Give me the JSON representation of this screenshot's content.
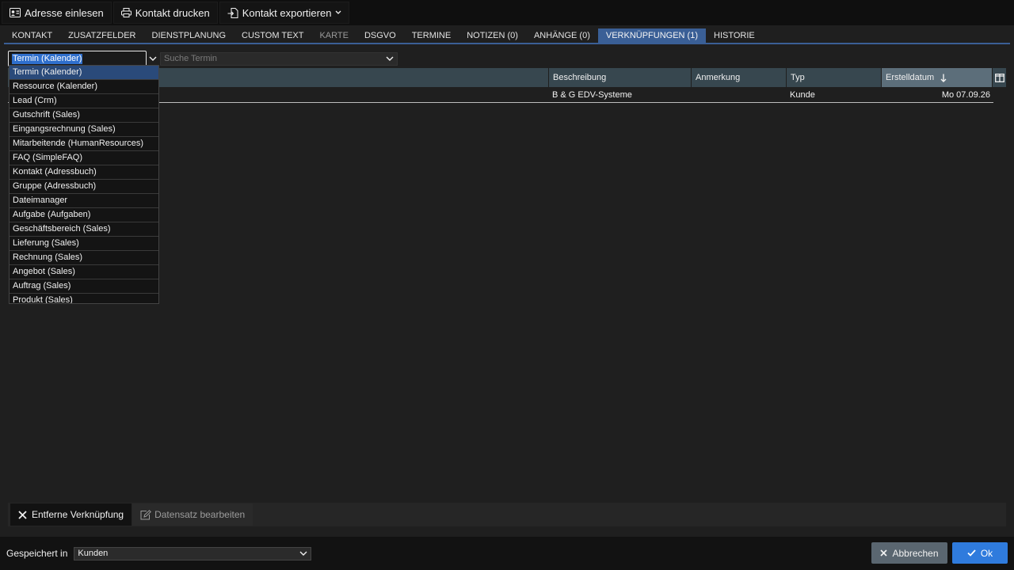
{
  "toolbar": {
    "import_address": "Adresse einlesen",
    "print_contact": "Kontakt drucken",
    "export_contact": "Kontakt exportieren"
  },
  "tabs": [
    {
      "label": "KONTAKT",
      "state": "normal"
    },
    {
      "label": "ZUSATZFELDER",
      "state": "normal"
    },
    {
      "label": "DIENSTPLANUNG",
      "state": "normal"
    },
    {
      "label": "CUSTOM TEXT",
      "state": "normal"
    },
    {
      "label": "KARTE",
      "state": "disabled"
    },
    {
      "label": "DSGVO",
      "state": "normal"
    },
    {
      "label": "TERMINE",
      "state": "normal"
    },
    {
      "label": "NOTIZEN (0)",
      "state": "normal"
    },
    {
      "label": "ANHÄNGE (0)",
      "state": "normal"
    },
    {
      "label": "VERKNÜPFUNGEN (1)",
      "state": "active"
    },
    {
      "label": "HISTORIE",
      "state": "normal"
    }
  ],
  "filter": {
    "type_value": "Termin  (Kalender)",
    "search_placeholder": "Suche Termin"
  },
  "grid": {
    "headers": [
      "Beschreibung",
      "Anmerkung",
      "Typ",
      "Erstelldatum"
    ],
    "rows": [
      {
        "beschreibung": "B & G EDV-Systeme",
        "anmerkung": "",
        "typ": "Kunde",
        "erstelldatum": "Mo 07.09.26"
      }
    ]
  },
  "dropdown_options": [
    "Termin (Kalender)",
    "Ressource (Kalender)",
    "Lead (Crm)",
    "Gutschrift (Sales)",
    "Eingangsrechnung (Sales)",
    "Mitarbeitende (HumanResources)",
    "FAQ (SimpleFAQ)",
    "Kontakt (Adressbuch)",
    "Gruppe (Adressbuch)",
    "Dateimanager",
    "Aufgabe (Aufgaben)",
    "Geschäftsbereich (Sales)",
    "Lieferung (Sales)",
    "Rechnung (Sales)",
    "Angebot (Sales)",
    "Auftrag (Sales)",
    "Produkt (Sales)"
  ],
  "bottom_bar": {
    "remove_link": "Entferne Verknüpfung",
    "edit_record": "Datensatz bearbeiten"
  },
  "footer": {
    "saved_in_label": "Gespeichert in",
    "saved_in_value": "Kunden",
    "cancel": "Abbrechen",
    "ok": "Ok"
  },
  "colors": {
    "accent_blue": "#3a5f96",
    "ok_button": "#2f7bdd",
    "cancel_button": "#5a6670"
  }
}
